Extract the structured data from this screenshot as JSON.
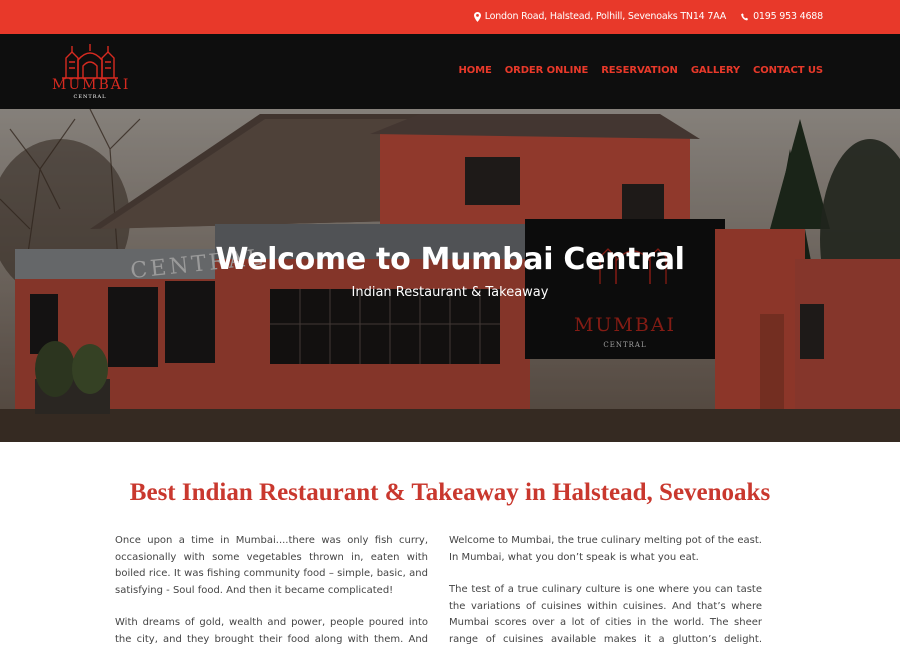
{
  "topbar": {
    "address": "London Road, Halstead, Polhill, Sevenoaks TN14 7AA",
    "phone": "0195 953 4688"
  },
  "brand": {
    "name": "MUMBAI",
    "tagline": "CENTRAL"
  },
  "nav": {
    "items": [
      "HOME",
      "ORDER ONLINE",
      "RESERVATION",
      "GALLERY",
      "CONTACT US"
    ]
  },
  "hero": {
    "title": "Welcome to Mumbai Central",
    "subtitle": "Indian Restaurant & Takeaway",
    "sign_text": "CENTRAL",
    "sign_logo_name": "MUMBAI",
    "sign_logo_tagline": "CENTRAL"
  },
  "content": {
    "heading": "Best Indian Restaurant & Takeaway in Halstead, Sevenoaks",
    "left_paragraphs": [
      "Once upon a time in Mumbai....there was only fish curry, occasionally with some vegetables thrown in, eaten with boiled rice. It was fishing community food – simple, basic, and satisfying - Soul food. And then it became complicated!",
      "With dreams of gold, wealth and power, people poured into the city, and they brought their food along with them. And soon the"
    ],
    "right_paragraphs": [
      "Welcome to Mumbai, the true culinary melting pot of the east. In Mumbai, what you don’t speak is what you eat.",
      "The test of a true culinary culture is one where you can taste the variations of cuisines within cuisines. And that’s where Mumbai scores over a lot of cities in the world. The sheer range of cuisines available makes it a glutton’s delight. Mumbai Central, inspired by the"
    ]
  },
  "colors": {
    "accent": "#e8392a",
    "header_bg": "#0e0e0e",
    "heading": "#c9382e"
  }
}
